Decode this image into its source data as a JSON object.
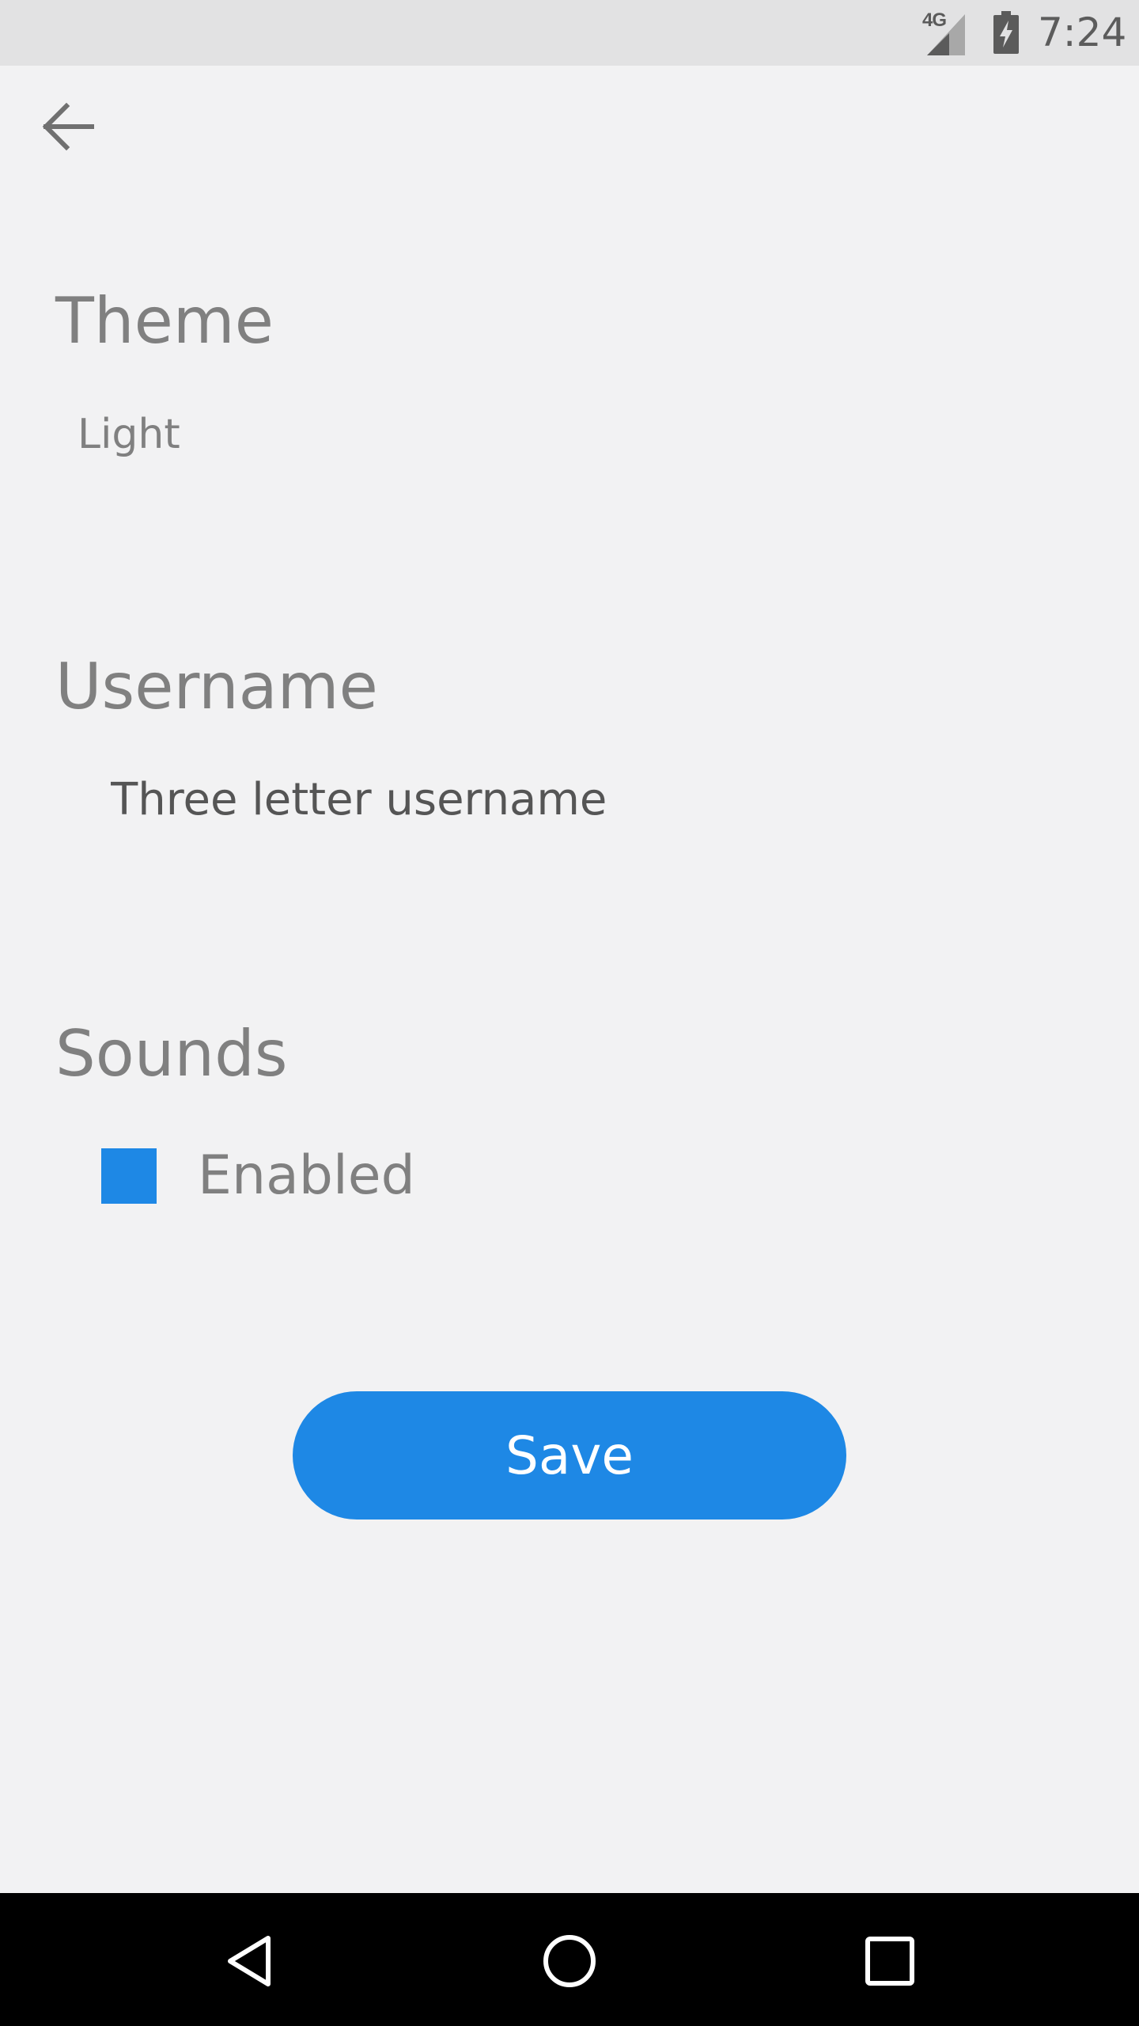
{
  "status_bar": {
    "network": "4G",
    "time": "7:24"
  },
  "toolbar": {
    "back_icon": "arrow-left-icon"
  },
  "theme": {
    "title": "Theme",
    "value": "Light"
  },
  "username": {
    "title": "Username",
    "placeholder": "Three letter username",
    "value": ""
  },
  "sounds": {
    "title": "Sounds",
    "enabled_label": "Enabled",
    "enabled": true
  },
  "actions": {
    "save_label": "Save"
  },
  "colors": {
    "accent": "#1e88e5",
    "background": "#f2f2f3",
    "status_bar": "#e2e2e3",
    "text_muted": "#808080",
    "nav_bar": "#000000"
  },
  "nav": {
    "back_icon": "triangle-back-icon",
    "home_icon": "circle-home-icon",
    "recents_icon": "square-recents-icon"
  }
}
